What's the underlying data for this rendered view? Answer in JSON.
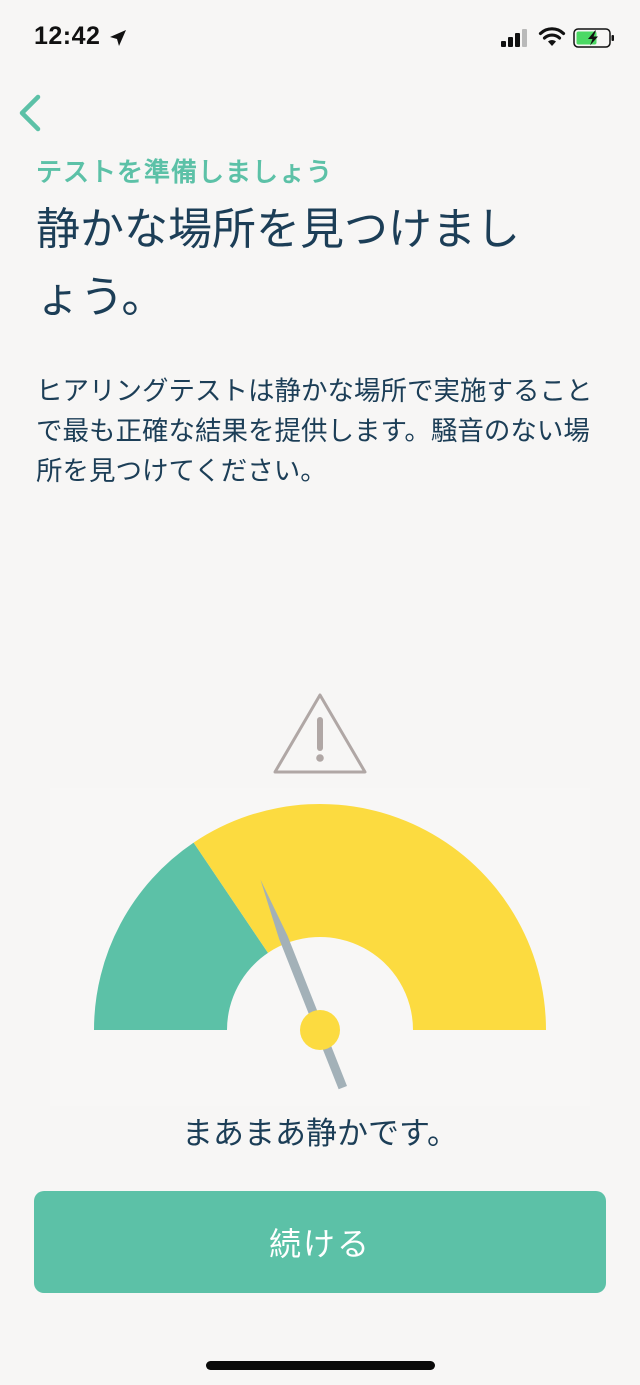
{
  "status_bar": {
    "time": "12:42",
    "icons": [
      "location-arrow-icon",
      "signal-icon",
      "wifi-icon",
      "battery-charging-icon"
    ]
  },
  "navigation": {
    "back_icon": "chevron-left-icon"
  },
  "content": {
    "eyebrow": "テストを準備しましょう",
    "headline": "静かな場所を見つけましょう。",
    "description": "ヒアリングテストは静かな場所で実施することで最も正確な結果を提供します。騒音のない場所を見つけてください。"
  },
  "noise_meter": {
    "warning_icon": "warning-triangle-icon",
    "status_label": "まあまあ静かです。",
    "level_fraction": 0.38,
    "colors": {
      "quiet_zone": "#5cc1a7",
      "moderate_zone": "#fcdb40",
      "needle": "#a3b1b8",
      "hub": "#fcdb40"
    }
  },
  "actions": {
    "continue_label": "続ける"
  },
  "theme": {
    "accent": "#5cc1a7",
    "text": "#1c3e57",
    "background": "#f7f6f5"
  }
}
